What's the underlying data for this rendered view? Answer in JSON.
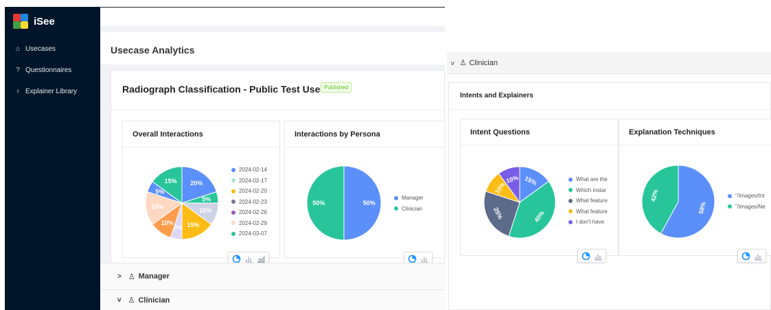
{
  "app": {
    "name": "iSee"
  },
  "sidebar": {
    "items": [
      {
        "label": "Usecases",
        "icon": "home-icon"
      },
      {
        "label": "Questionnaires",
        "icon": "question-icon"
      },
      {
        "label": "Explainer Library",
        "icon": "bulb-icon"
      }
    ]
  },
  "header": {
    "title": "Usecase Analytics"
  },
  "usecase": {
    "title": "Radiograph Classification - Public Test Use Case",
    "status": "Published"
  },
  "panels": {
    "overall": {
      "title": "Overall Interactions"
    },
    "persona": {
      "title": "Interactions by Persona"
    },
    "intent": {
      "title": "Intent Questions"
    },
    "explanation": {
      "title": "Explanation Techniques"
    }
  },
  "collapses": {
    "manager": "Manager",
    "clinician": "Clinician",
    "right_clinician": "Clinician"
  },
  "intents_card": {
    "title": "Intents and Explainers"
  },
  "colors": {
    "accent": "#1890ff",
    "sidebar_bg": "#001529",
    "published": "#52c41a"
  },
  "chart_data": [
    {
      "type": "pie",
      "title": "Overall Interactions",
      "series": [
        {
          "name": "2024-02-14",
          "value": 20,
          "label": "20%",
          "color": "#5b8ff9"
        },
        {
          "name": "2024-02-14",
          "value": 5,
          "label": "5%",
          "color": "#28c59a"
        },
        {
          "name": "2024-02-17",
          "value": 10,
          "label": "10%",
          "color": "#cfd3e6"
        },
        {
          "name": "2024-02-20",
          "value": 15,
          "label": "15%",
          "color": "#fbbd15"
        },
        {
          "name": "2024-02-20",
          "value": 5,
          "label": "5%",
          "color": "#dcd6f7"
        },
        {
          "name": "2024-02-23",
          "value": 10,
          "label": "10%",
          "color": "#ff9d4d"
        },
        {
          "name": "2024-02-29",
          "value": 15,
          "label": "15%",
          "color": "#ffd8c2"
        },
        {
          "name": "2024-02-29",
          "value": 5,
          "label": "5%",
          "color": "#5b8ff9"
        },
        {
          "name": "2024-03-07",
          "value": 15,
          "label": "15%",
          "color": "#28c59a"
        }
      ],
      "legend": [
        {
          "name": "2024-02-14",
          "color": "#5b8ff9"
        },
        {
          "name": "2024-02-17",
          "color": "#a9e4c8"
        },
        {
          "name": "2024-02-20",
          "color": "#fbbd15"
        },
        {
          "name": "2024-02-23",
          "color": "#6b7794"
        },
        {
          "name": "2024-02-26",
          "color": "#9b59b6"
        },
        {
          "name": "2024-02-29",
          "color": "#ffd8c2"
        },
        {
          "name": "2024-03-07",
          "color": "#28c59a"
        }
      ],
      "legend_position": "right"
    },
    {
      "type": "pie",
      "title": "Interactions by Persona",
      "series": [
        {
          "name": "Manager",
          "value": 50,
          "label": "50%",
          "color": "#5b8ff9"
        },
        {
          "name": "Clinician",
          "value": 50,
          "label": "50%",
          "color": "#28c59a"
        }
      ],
      "legend_position": "right"
    },
    {
      "type": "pie",
      "title": "Intent Questions",
      "series": [
        {
          "name": "What are the",
          "value": 15,
          "label": "15%",
          "color": "#5b8ff9"
        },
        {
          "name": "Which instar",
          "value": 40,
          "label": "40%",
          "color": "#28c59a"
        },
        {
          "name": "What feature",
          "value": 25,
          "label": "25%",
          "color": "#5d6b8a"
        },
        {
          "name": "What feature",
          "value": 10,
          "label": "10%",
          "color": "#fbbd15"
        },
        {
          "name": "I don't have",
          "value": 10,
          "label": "10%",
          "color": "#7a5ee8"
        }
      ],
      "legend_position": "right"
    },
    {
      "type": "pie",
      "title": "Explanation Techniques",
      "series": [
        {
          "name": "\"/Images/Int",
          "value": 58,
          "label": "58%",
          "color": "#5b8ff9"
        },
        {
          "name": "\"/Images/Ne",
          "value": 42,
          "label": "42%",
          "color": "#28c59a"
        }
      ],
      "legend_position": "right"
    }
  ]
}
